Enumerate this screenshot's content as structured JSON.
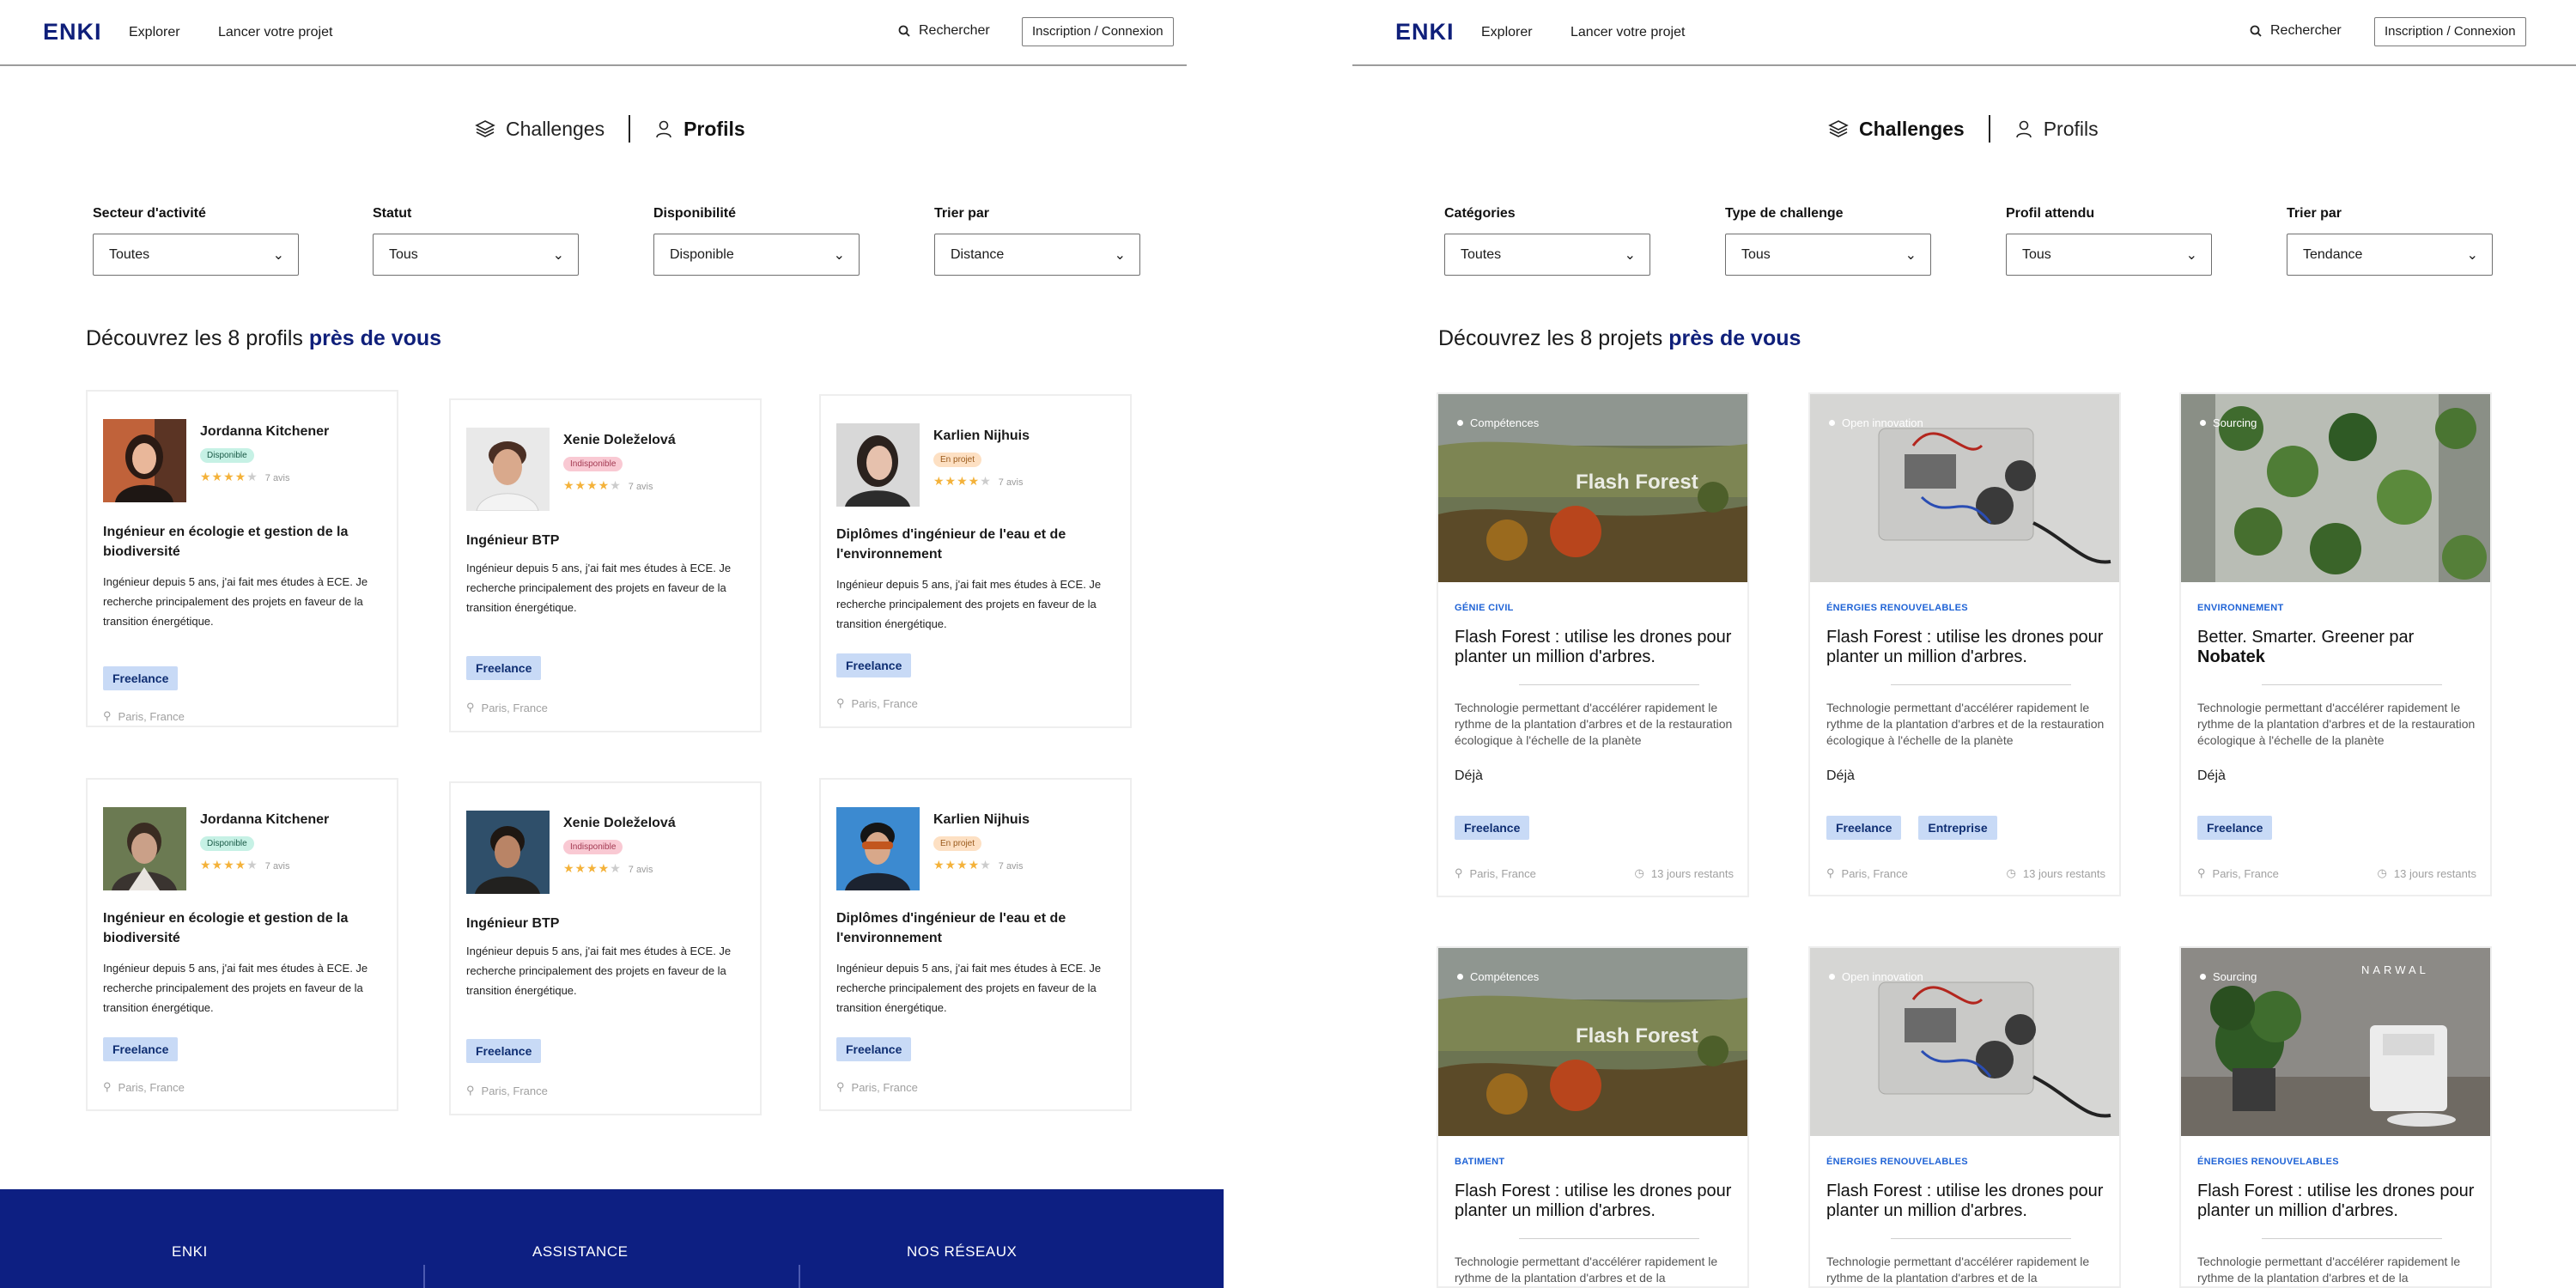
{
  "left": {
    "header": {
      "logo": "ENKI",
      "nav": [
        "Explorer",
        "Lancer votre projet"
      ],
      "search_label": "Rechercher",
      "login_label": "Inscription / Connexion"
    },
    "tabs": [
      {
        "label": "Challenges",
        "active": false
      },
      {
        "label": "Profils",
        "active": true
      }
    ],
    "filters": [
      {
        "label": "Secteur d'activité",
        "value": "Toutes"
      },
      {
        "label": "Statut",
        "value": "Tous"
      },
      {
        "label": "Disponibilité",
        "value": "Disponible"
      },
      {
        "label": "Trier par",
        "value": "Distance"
      }
    ],
    "headline": {
      "prefix": "Découvrez les 8 profils ",
      "accent": "près de vous"
    },
    "profiles": [
      {
        "name": "Jordanna Kitchener",
        "status": "Disponible",
        "rating": 4,
        "reviews": "7 avis",
        "title": "Ingénieur en écologie et gestion de la biodiversité",
        "desc": "Ingénieur depuis 5 ans, j'ai fait mes études à ECE. Je recherche principalement des projets en faveur de la transition énergétique.",
        "tag": "Freelance",
        "location": "Paris, France"
      },
      {
        "name": "Xenie Doleželová",
        "status": "Indisponible",
        "rating": 4,
        "reviews": "7 avis",
        "title": "Ingénieur BTP",
        "desc": "Ingénieur depuis 5 ans, j'ai fait mes études à ECE. Je recherche principalement des projets en faveur de la transition énergétique.",
        "tag": "Freelance",
        "location": "Paris, France"
      },
      {
        "name": "Karlien Nijhuis",
        "status": "En projet",
        "rating": 4,
        "reviews": "7 avis",
        "title": "Diplômes d'ingénieur de l'eau et de l'environnement",
        "desc": "Ingénieur depuis 5 ans, j'ai fait mes études à ECE. Je recherche principalement des projets en faveur de la transition énergétique.",
        "tag": "Freelance",
        "location": "Paris, France"
      },
      {
        "name": "Jordanna Kitchener",
        "status": "Disponible",
        "rating": 4,
        "reviews": "7 avis",
        "title": "Ingénieur en écologie et gestion de la biodiversité",
        "desc": "Ingénieur depuis 5 ans, j'ai fait mes études à ECE. Je recherche principalement des projets en faveur de la transition énergétique.",
        "tag": "Freelance",
        "location": "Paris, France"
      },
      {
        "name": "Xenie Doleželová",
        "status": "Indisponible",
        "rating": 4,
        "reviews": "7 avis",
        "title": "Ingénieur BTP",
        "desc": "Ingénieur depuis 5 ans, j'ai fait mes études à ECE. Je recherche principalement des projets en faveur de la transition énergétique.",
        "tag": "Freelance",
        "location": "Paris, France"
      },
      {
        "name": "Karlien Nijhuis",
        "status": "En projet",
        "rating": 4,
        "reviews": "7 avis",
        "title": "Diplômes d'ingénieur de l'eau et de l'environnement",
        "desc": "Ingénieur depuis 5 ans, j'ai fait mes études à ECE. Je recherche principalement des projets en faveur de la transition énergétique.",
        "tag": "Freelance",
        "location": "Paris, France"
      }
    ],
    "footer": [
      "ENKI",
      "ASSISTANCE",
      "NOS RÉSEAUX"
    ]
  },
  "right": {
    "header": {
      "logo": "ENKI",
      "nav": [
        "Explorer",
        "Lancer votre projet"
      ],
      "search_label": "Rechercher",
      "login_label": "Inscription / Connexion"
    },
    "tabs": [
      {
        "label": "Challenges",
        "active": true
      },
      {
        "label": "Profils",
        "active": false
      }
    ],
    "filters": [
      {
        "label": "Catégories",
        "value": "Toutes"
      },
      {
        "label": "Type de challenge",
        "value": "Tous"
      },
      {
        "label": "Profil attendu",
        "value": "Tous"
      },
      {
        "label": "Trier par",
        "value": "Tendance"
      }
    ],
    "headline": {
      "prefix": "Découvrez les 8 projets ",
      "accent": "près de vous"
    },
    "projects": [
      {
        "type": "Compétences",
        "category": "GÉNIE CIVIL",
        "title": "Flash Forest : utilise les drones pour planter un million d'arbres.",
        "title_bold": "",
        "desc": "Technologie permettant d'accélérer rapidement le rythme de la plantation d'arbres et de la restauration écologique à l'échelle de la planète",
        "deja": "Déjà",
        "tags": [
          "Freelance"
        ],
        "location": "Paris, France",
        "remaining": "13 jours restants",
        "image_text": "Flash Forest"
      },
      {
        "type": "Open innovation",
        "category": "ÉNERGIES RENOUVELABLES",
        "title": "Flash Forest : utilise les drones pour planter un million d'arbres.",
        "title_bold": "",
        "desc": "Technologie permettant d'accélérer rapidement le rythme de la plantation d'arbres et de la restauration écologique à l'échelle de la planète",
        "deja": "Déjà",
        "tags": [
          "Freelance",
          "Entreprise"
        ],
        "location": "Paris, France",
        "remaining": "13 jours restants",
        "image_text": ""
      },
      {
        "type": "Sourcing",
        "category": "ENVIRONNEMENT",
        "title": "Better. Smarter. Greener par ",
        "title_bold": "Nobatek",
        "desc": "Technologie permettant d'accélérer rapidement le rythme de la plantation d'arbres et de la restauration écologique à l'échelle de la planète",
        "deja": "Déjà",
        "tags": [
          "Freelance"
        ],
        "location": "Paris, France",
        "remaining": "13 jours restants",
        "image_text": ""
      },
      {
        "type": "Compétences",
        "category": "BATIMENT",
        "title": "Flash Forest : utilise les drones pour planter un million d'arbres.",
        "title_bold": "",
        "desc": "Technologie permettant d'accélérer rapidement le rythme de la plantation d'arbres et de la",
        "deja": "",
        "tags": [],
        "location": "",
        "remaining": "",
        "image_text": "Flash Forest"
      },
      {
        "type": "Open innovation",
        "category": "ÉNERGIES RENOUVELABLES",
        "title": "Flash Forest : utilise les drones pour planter un million d'arbres.",
        "title_bold": "",
        "desc": "Technologie permettant d'accélérer rapidement le rythme de la plantation d'arbres et de la",
        "deja": "",
        "tags": [],
        "location": "",
        "remaining": "",
        "image_text": ""
      },
      {
        "type": "Sourcing",
        "category": "ÉNERGIES RENOUVELABLES",
        "title": "Flash Forest : utilise les drones pour planter un million d'arbres.",
        "title_bold": "",
        "desc": "Technologie permettant d'accélérer rapidement le rythme de la plantation d'arbres et de la",
        "deja": "",
        "tags": [],
        "location": "",
        "remaining": "",
        "image_text": "NARWAL"
      }
    ]
  },
  "colors": {
    "brand": "#0f1f7a",
    "footer": "#0d1f82",
    "chip": "#c8daf6",
    "category": "#1f63d6",
    "star": "#f4b23a"
  }
}
